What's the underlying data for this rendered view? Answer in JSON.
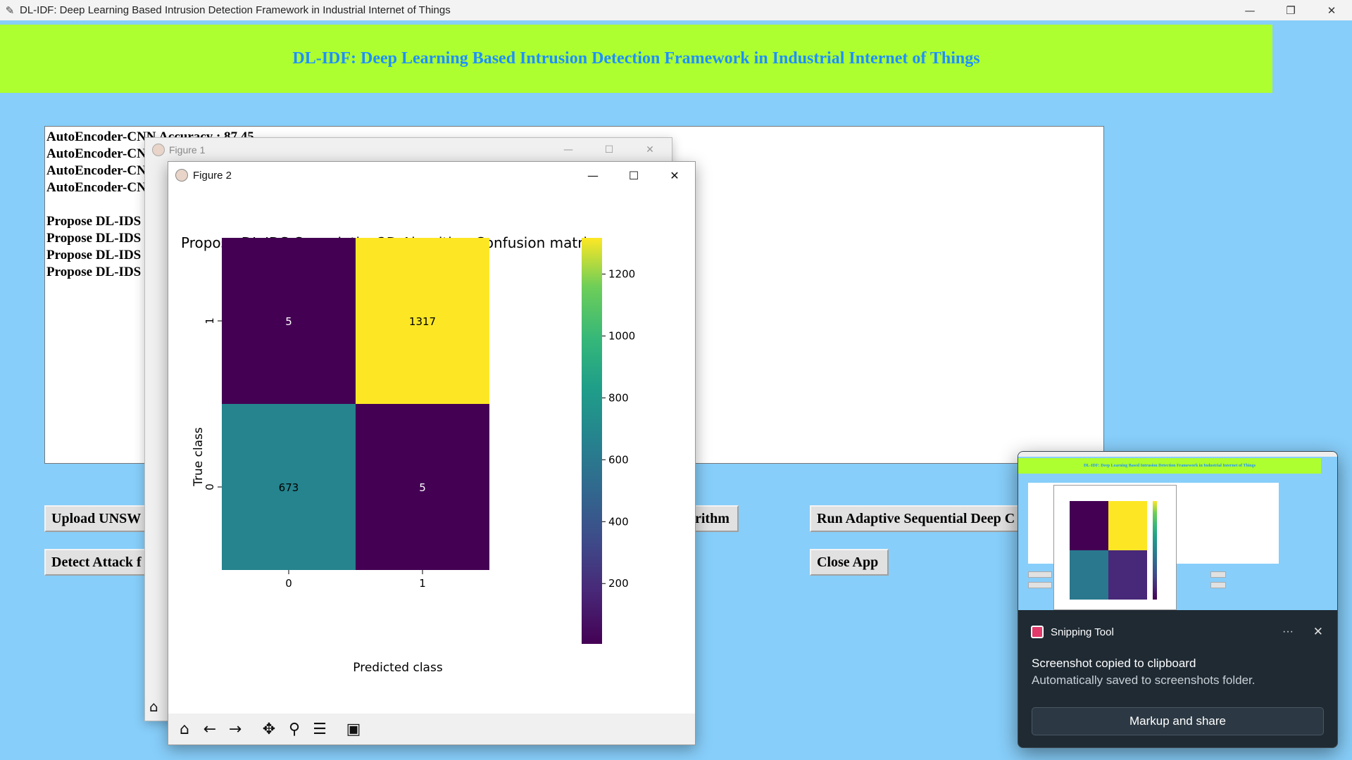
{
  "window": {
    "title": "DL-IDF: Deep Learning Based Intrusion Detection Framework in Industrial Internet of Things",
    "minimize": "—",
    "restore": "❐",
    "close": "✕"
  },
  "header": {
    "title": "DL-IDF: Deep Learning Based Intrusion Detection Framework in Industrial Internet of Things"
  },
  "output": {
    "lines": [
      "AutoEncoder-CNN Accuracy  :  87.45",
      "AutoEncoder-CN",
      "AutoEncoder-CN",
      "AutoEncoder-CN",
      "",
      "Propose DL-IDS",
      "Propose DL-IDS",
      "Propose DL-IDS",
      "Propose DL-IDS"
    ]
  },
  "buttons": {
    "upload": "Upload UNSW",
    "detect": "Detect Attack f",
    "algorithm_partial": "rithm",
    "run_adaptive": "Run Adaptive Sequential Deep C",
    "close_app": "Close App"
  },
  "figure1": {
    "title": "Figure 1"
  },
  "figure2": {
    "title": "Figure 2"
  },
  "chart_data": {
    "type": "heatmap",
    "title": "Propose DL-IDS Convolution2D Algorithm Confusion matrix",
    "xlabel": "Predicted class",
    "ylabel": "True class",
    "x_ticks": [
      "0",
      "1"
    ],
    "y_ticks": [
      "1",
      "0"
    ],
    "matrix_rows_top_to_bottom": [
      {
        "true": "1",
        "values": [
          5,
          1317
        ]
      },
      {
        "true": "0",
        "values": [
          673,
          5
        ]
      }
    ],
    "colormap": "viridis",
    "colorbar": {
      "range": [
        5,
        1317
      ],
      "ticks": [
        200,
        400,
        600,
        800,
        1000,
        1200
      ]
    },
    "colors": {
      "low": "#440154",
      "mid": "#21918c",
      "high": "#fde725"
    }
  },
  "toast": {
    "app_name": "Snipping Tool",
    "more": "···",
    "close": "✕",
    "message": "Screenshot copied to clipboard",
    "subtext": "Automatically saved to screenshots folder.",
    "action": "Markup and share"
  }
}
